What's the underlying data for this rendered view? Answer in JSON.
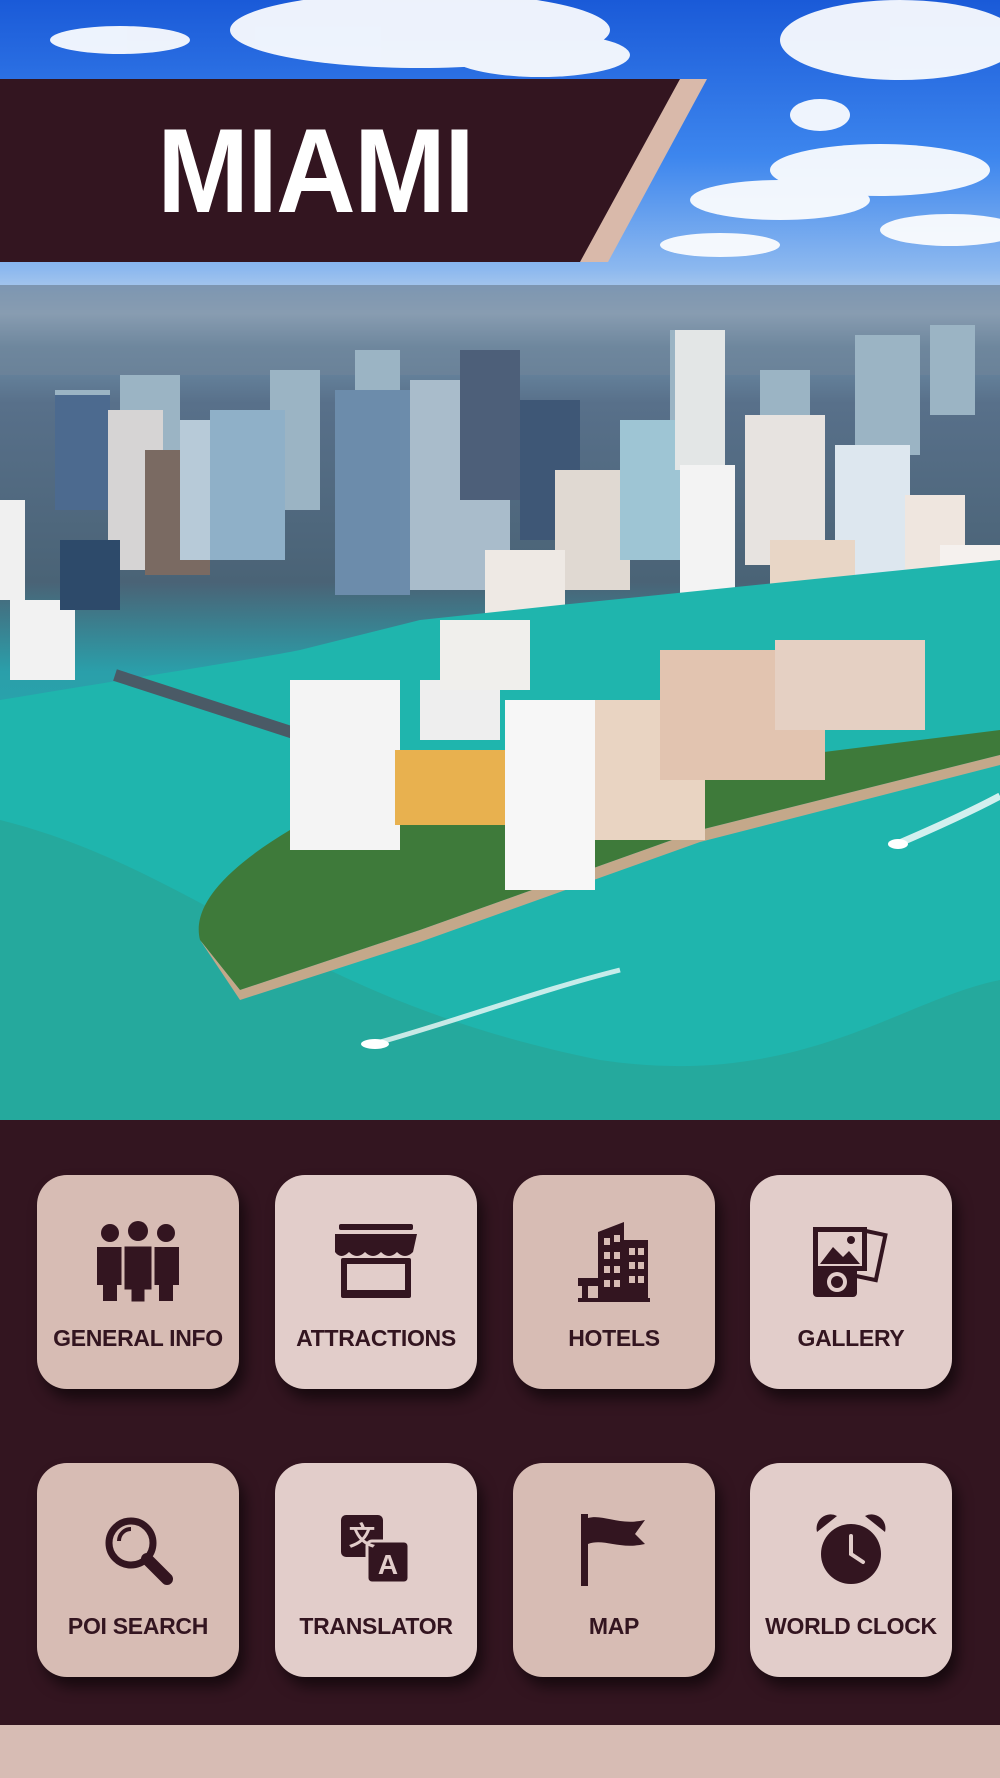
{
  "app": {
    "title": "MIAMI"
  },
  "colors": {
    "background": "#331520",
    "tile_dark": "#d7bcb4",
    "tile_light": "#e2cdca",
    "icon": "#331520",
    "banner_accent": "#d9b9aa"
  },
  "menu": {
    "items": [
      {
        "label": "GENERAL INFO",
        "icon": "people-icon"
      },
      {
        "label": "ATTRACTIONS",
        "icon": "storefront-icon"
      },
      {
        "label": "HOTELS",
        "icon": "building-icon"
      },
      {
        "label": "GALLERY",
        "icon": "photo-camera-icon"
      },
      {
        "label": "POI SEARCH",
        "icon": "magnifier-icon"
      },
      {
        "label": "TRANSLATOR",
        "icon": "translate-icon"
      },
      {
        "label": "MAP",
        "icon": "flag-icon"
      },
      {
        "label": "WORLD CLOCK",
        "icon": "alarm-clock-icon"
      }
    ]
  }
}
